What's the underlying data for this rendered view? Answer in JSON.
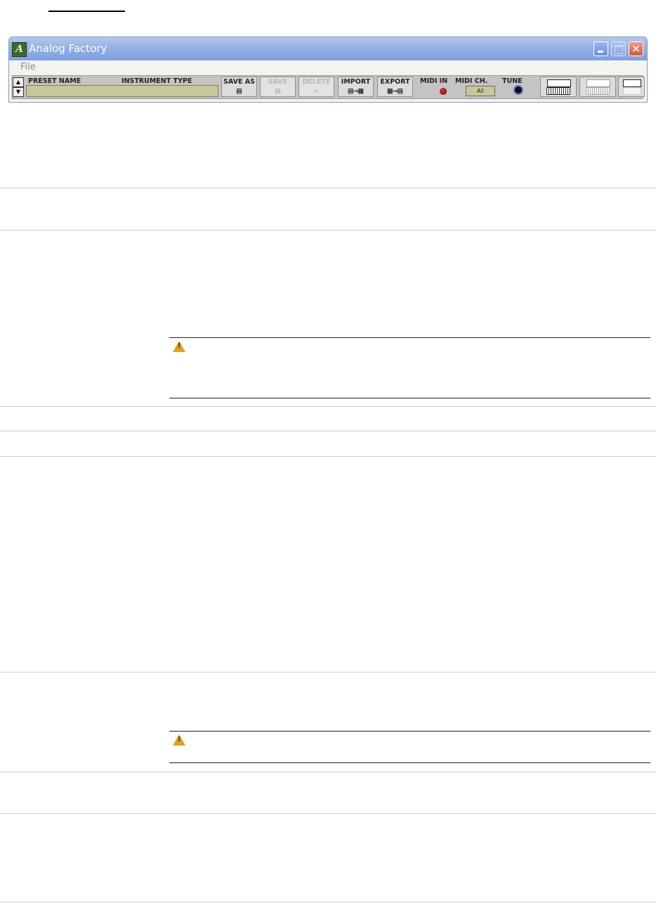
{
  "window": {
    "title": "Analog Factory",
    "close_glyph": "✕"
  },
  "menu": {
    "file_label": "File"
  },
  "toolbar": {
    "up_glyph": "▲",
    "down_glyph": "▼",
    "preset_name_label": "PRESET NAME",
    "instrument_type_label": "INSTRUMENT TYPE",
    "preset_name_value": "",
    "save_as_label": "SAVE AS",
    "save_label": "SAVE",
    "delete_label": "DELETE",
    "import_label": "IMPORT",
    "export_label": "EXPORT",
    "midi_in_label": "MIDI IN",
    "midi_ch_label": "MIDI CH.",
    "midi_ch_value": "All",
    "tune_label": "TUNE",
    "save_as_icon": "disk-icon",
    "save_icon": "disk-icon",
    "delete_icon": "x-icon",
    "import_glyph": "▤→▦",
    "export_glyph": "▦→▤",
    "save_as_glyph": "▤",
    "save_glyph": "▤",
    "delete_glyph": "✕"
  },
  "icons": {
    "app": "analog-factory-logo-icon",
    "warning": "warning-icon"
  },
  "colors": {
    "titlebar": "#93b0e6",
    "field": "#c8c79c",
    "led": "#cc2222"
  }
}
